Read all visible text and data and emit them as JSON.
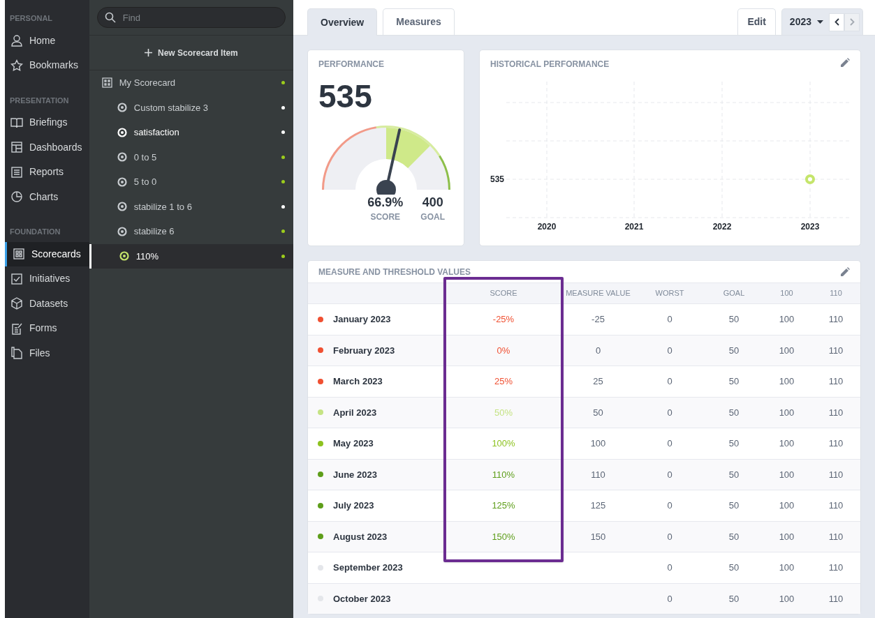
{
  "nav": [
    {
      "heading": "PERSONAL",
      "items": [
        {
          "label": "Home",
          "selected": false
        },
        {
          "label": "Bookmarks",
          "selected": false
        }
      ]
    },
    {
      "heading": "PRESENTATION",
      "items": [
        {
          "label": "Briefings",
          "selected": false
        },
        {
          "label": "Dashboards",
          "selected": false
        },
        {
          "label": "Reports",
          "selected": false
        },
        {
          "label": "Charts",
          "selected": false
        }
      ]
    },
    {
      "heading": "FOUNDATION",
      "items": [
        {
          "label": "Scorecards",
          "selected": true
        },
        {
          "label": "Initiatives",
          "selected": false
        },
        {
          "label": "Datasets",
          "selected": false
        },
        {
          "label": "Forms",
          "selected": false
        },
        {
          "label": "Files",
          "selected": false
        }
      ]
    }
  ],
  "search": {
    "placeholder": "Find"
  },
  "new_item_button": "New Scorecard Item",
  "tree": {
    "label": "My Scorecard",
    "color": "#9ccc1c",
    "children": [
      {
        "label": "Custom stabilize 3",
        "color": "#ffffff",
        "highlighted": false,
        "selected": false
      },
      {
        "label": "satisfaction",
        "color": "#ffffff",
        "highlighted": true,
        "selected": false
      },
      {
        "label": "0 to 5",
        "color": "#9ccc1c",
        "highlighted": false,
        "selected": false
      },
      {
        "label": "5 to 0",
        "color": "#9ccc1c",
        "highlighted": false,
        "selected": false
      },
      {
        "label": "stabilize 1 to 6",
        "color": "#ffffff",
        "highlighted": false,
        "selected": false
      },
      {
        "label": "stabilize 6",
        "color": "#9ccc1c",
        "highlighted": false,
        "selected": false
      },
      {
        "label": "110%",
        "color": "#9ccc1c",
        "highlighted": false,
        "selected": true
      }
    ]
  },
  "tabs": [
    {
      "label": "Overview",
      "selected": true
    },
    {
      "label": "Measures",
      "selected": false
    }
  ],
  "edit_button": "Edit",
  "year_select": "2023",
  "performance": {
    "title": "PERFORMANCE",
    "value": "535",
    "level": 0.57,
    "score": "66.9%",
    "score_label": "SCORE",
    "goal": "400",
    "goal_label": "GOAL"
  },
  "historical": {
    "title": "HISTORICAL PERFORMANCE",
    "x_labels": [
      "2020",
      "2021",
      "2022",
      "2023"
    ],
    "y_label": "535"
  },
  "table": {
    "title": "MEASURE AND THRESHOLD VALUES",
    "columns": [
      "SCORE",
      "MEASURE VALUE",
      "WORST",
      "GOAL",
      "100",
      "110"
    ],
    "rows": [
      {
        "name": "January 2023",
        "color": "#f05032",
        "score": "-25%",
        "measure": "-25",
        "worst": "0",
        "goal": "50",
        "t100": "100",
        "t110": "110"
      },
      {
        "name": "February 2023",
        "color": "#f05032",
        "score": "0%",
        "measure": "0",
        "worst": "0",
        "goal": "50",
        "t100": "100",
        "t110": "110"
      },
      {
        "name": "March 2023",
        "color": "#f05032",
        "score": "25%",
        "measure": "25",
        "worst": "0",
        "goal": "50",
        "t100": "100",
        "t110": "110"
      },
      {
        "name": "April 2023",
        "color": "#c5e384",
        "score": "50%",
        "measure": "50",
        "worst": "0",
        "goal": "50",
        "t100": "100",
        "t110": "110"
      },
      {
        "name": "May 2023",
        "color": "#8dc21f",
        "score": "100%",
        "measure": "100",
        "worst": "0",
        "goal": "50",
        "t100": "100",
        "t110": "110"
      },
      {
        "name": "June 2023",
        "color": "#5e9e1a",
        "score": "110%",
        "measure": "110",
        "worst": "0",
        "goal": "50",
        "t100": "100",
        "t110": "110"
      },
      {
        "name": "July 2023",
        "color": "#5e9e1a",
        "score": "125%",
        "measure": "125",
        "worst": "0",
        "goal": "50",
        "t100": "100",
        "t110": "110"
      },
      {
        "name": "August 2023",
        "color": "#5e9e1a",
        "score": "150%",
        "measure": "150",
        "worst": "0",
        "goal": "50",
        "t100": "100",
        "t110": "110"
      },
      {
        "name": "September 2023",
        "color": "#e4e6ea",
        "worst": "0",
        "goal": "50",
        "t100": "100",
        "t110": "110"
      },
      {
        "name": "October 2023",
        "color": "#e4e6ea",
        "worst": "0",
        "goal": "50",
        "t100": "100",
        "t110": "110"
      }
    ]
  }
}
